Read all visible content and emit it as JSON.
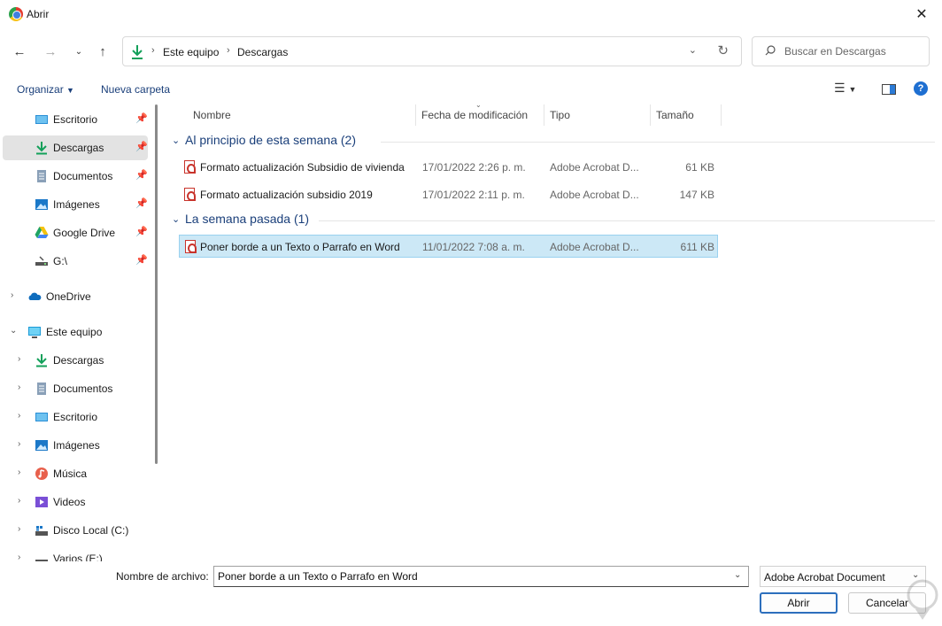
{
  "window": {
    "title": "Abrir"
  },
  "address": {
    "crumbs": [
      "Este equipo",
      "Descargas"
    ],
    "search_placeholder": "Buscar en Descargas"
  },
  "toolbar": {
    "organize": "Organizar",
    "new_folder": "Nueva carpeta"
  },
  "sidebar": {
    "quick_access": [
      {
        "label": "Escritorio",
        "icon": "desktop-icon"
      },
      {
        "label": "Descargas",
        "icon": "download-icon",
        "selected": true
      },
      {
        "label": "Documentos",
        "icon": "document-icon"
      },
      {
        "label": "Imágenes",
        "icon": "image-icon"
      },
      {
        "label": "Google Drive",
        "icon": "google-drive-icon"
      },
      {
        "label": "G:\\",
        "icon": "drive-icon"
      }
    ],
    "onedrive": "OneDrive",
    "this_pc": "Este equipo",
    "pc_items": [
      {
        "label": "Descargas",
        "icon": "download-icon"
      },
      {
        "label": "Documentos",
        "icon": "document-icon"
      },
      {
        "label": "Escritorio",
        "icon": "desktop-icon"
      },
      {
        "label": "Imágenes",
        "icon": "image-icon"
      },
      {
        "label": "Música",
        "icon": "music-icon"
      },
      {
        "label": "Videos",
        "icon": "video-icon"
      },
      {
        "label": "Disco Local (C:)",
        "icon": "disk-icon"
      },
      {
        "label": "Varios (E:)",
        "icon": "disk-icon"
      }
    ]
  },
  "columns": {
    "name": "Nombre",
    "date": "Fecha de modificación",
    "type": "Tipo",
    "size": "Tamaño"
  },
  "groups": [
    {
      "label": "Al principio de esta semana (2)",
      "files": [
        {
          "name": "Formato actualización Subsidio de vivienda",
          "date": "17/01/2022 2:26 p. m.",
          "type": "Adobe Acrobat D...",
          "size": "61 KB"
        },
        {
          "name": "Formato actualización subsidio 2019",
          "date": "17/01/2022 2:11 p. m.",
          "type": "Adobe Acrobat D...",
          "size": "147 KB"
        }
      ]
    },
    {
      "label": "La semana pasada (1)",
      "files": [
        {
          "name": "Poner borde a un Texto o Parrafo en Word",
          "date": "11/01/2022 7:08 a. m.",
          "type": "Adobe Acrobat D...",
          "size": "611 KB",
          "selected": true
        }
      ]
    }
  ],
  "footer": {
    "filename_label": "Nombre de archivo:",
    "filename_value": "Poner borde a un Texto o Parrafo en Word",
    "filetype": "Adobe Acrobat Document",
    "open": "Abrir",
    "cancel": "Cancelar"
  },
  "colors": {
    "accent": "#2c6fbd",
    "selection": "#cce8f6",
    "group_text": "#1a3f7a",
    "pdf_red": "#c8332b"
  }
}
